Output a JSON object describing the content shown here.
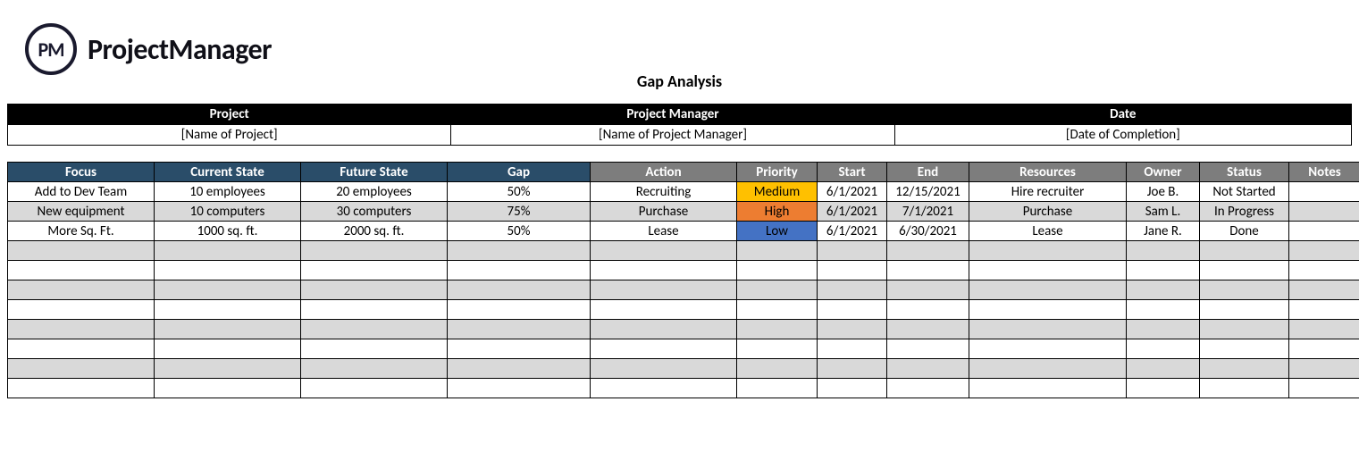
{
  "brand": {
    "logo_badge": "PM",
    "logo_text": "ProjectManager"
  },
  "title": "Gap Analysis",
  "meta": {
    "headers": {
      "project": "Project",
      "manager": "Project Manager",
      "date": "Date"
    },
    "values": {
      "project": "[Name of Project]",
      "manager": "[Name of Project Manager]",
      "date": "[Date of Completion]"
    }
  },
  "columns": {
    "focus": "Focus",
    "current": "Current State",
    "future": "Future State",
    "gap": "Gap",
    "action": "Action",
    "priority": "Priority",
    "start": "Start",
    "end": "End",
    "resources": "Resources",
    "owner": "Owner",
    "status": "Status",
    "notes": "Notes"
  },
  "rows": [
    {
      "focus": "Add to Dev Team",
      "current": "10 employees",
      "future": "20 employees",
      "gap": "50%",
      "action": "Recruiting",
      "priority": "Medium",
      "priority_class": "priority-medium",
      "start": "6/1/2021",
      "end": "12/15/2021",
      "resources": "Hire recruiter",
      "owner": "Joe B.",
      "status": "Not Started",
      "notes": ""
    },
    {
      "focus": "New equipment",
      "current": "10 computers",
      "future": "30 computers",
      "gap": "75%",
      "action": "Purchase",
      "priority": "High",
      "priority_class": "priority-high",
      "start": "6/1/2021",
      "end": "7/1/2021",
      "resources": "Purchase",
      "owner": "Sam L.",
      "status": "In Progress",
      "notes": ""
    },
    {
      "focus": "More Sq. Ft.",
      "current": "1000 sq. ft.",
      "future": "2000 sq. ft.",
      "gap": "50%",
      "action": "Lease",
      "priority": "Low",
      "priority_class": "priority-low",
      "start": "6/1/2021",
      "end": "6/30/2021",
      "resources": "Lease",
      "owner": "Jane R.",
      "status": "Done",
      "notes": ""
    }
  ],
  "empty_row_count": 8
}
